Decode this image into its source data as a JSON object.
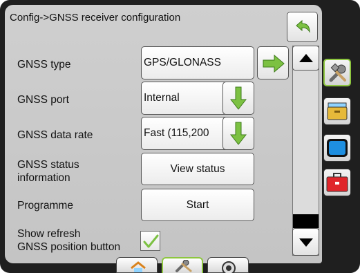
{
  "header": {
    "title": "Config->GNSS receiver configuration"
  },
  "rows": [
    {
      "label": "GNSS type",
      "value": "GPS/GLONASS",
      "control": "next-arrow"
    },
    {
      "label": "GNSS port",
      "value": "Internal",
      "control": "down-arrow"
    },
    {
      "label": "GNSS data rate",
      "value": "Fast (115,200",
      "control": "down-arrow"
    },
    {
      "label": "GNSS status information",
      "value": "View status",
      "control": "button"
    },
    {
      "label": "Programme",
      "value": "Start",
      "control": "button"
    },
    {
      "label": "Show refresh GNSS position button",
      "checked": true,
      "control": "checkbox"
    }
  ],
  "status_label_lines": [
    "GNSS status",
    "information"
  ],
  "refresh_label_lines": [
    "Show refresh",
    "GNSS position button"
  ],
  "side_tabs": [
    {
      "icon": "tools-icon",
      "active": true
    },
    {
      "icon": "folder-icon",
      "active": false
    },
    {
      "icon": "display-icon",
      "active": false
    },
    {
      "icon": "toolbox-icon",
      "active": false
    }
  ],
  "bottom_tabs": [
    {
      "icon": "home-icon",
      "active": false
    },
    {
      "icon": "tools-icon",
      "active": true
    },
    {
      "icon": "gauge-icon",
      "active": false
    }
  ],
  "colors": {
    "accent_green": "#8dc63f",
    "panel_bg": "#c8c8c8",
    "frame": "#1f1f1f",
    "scroll_thumb": "#000000"
  }
}
